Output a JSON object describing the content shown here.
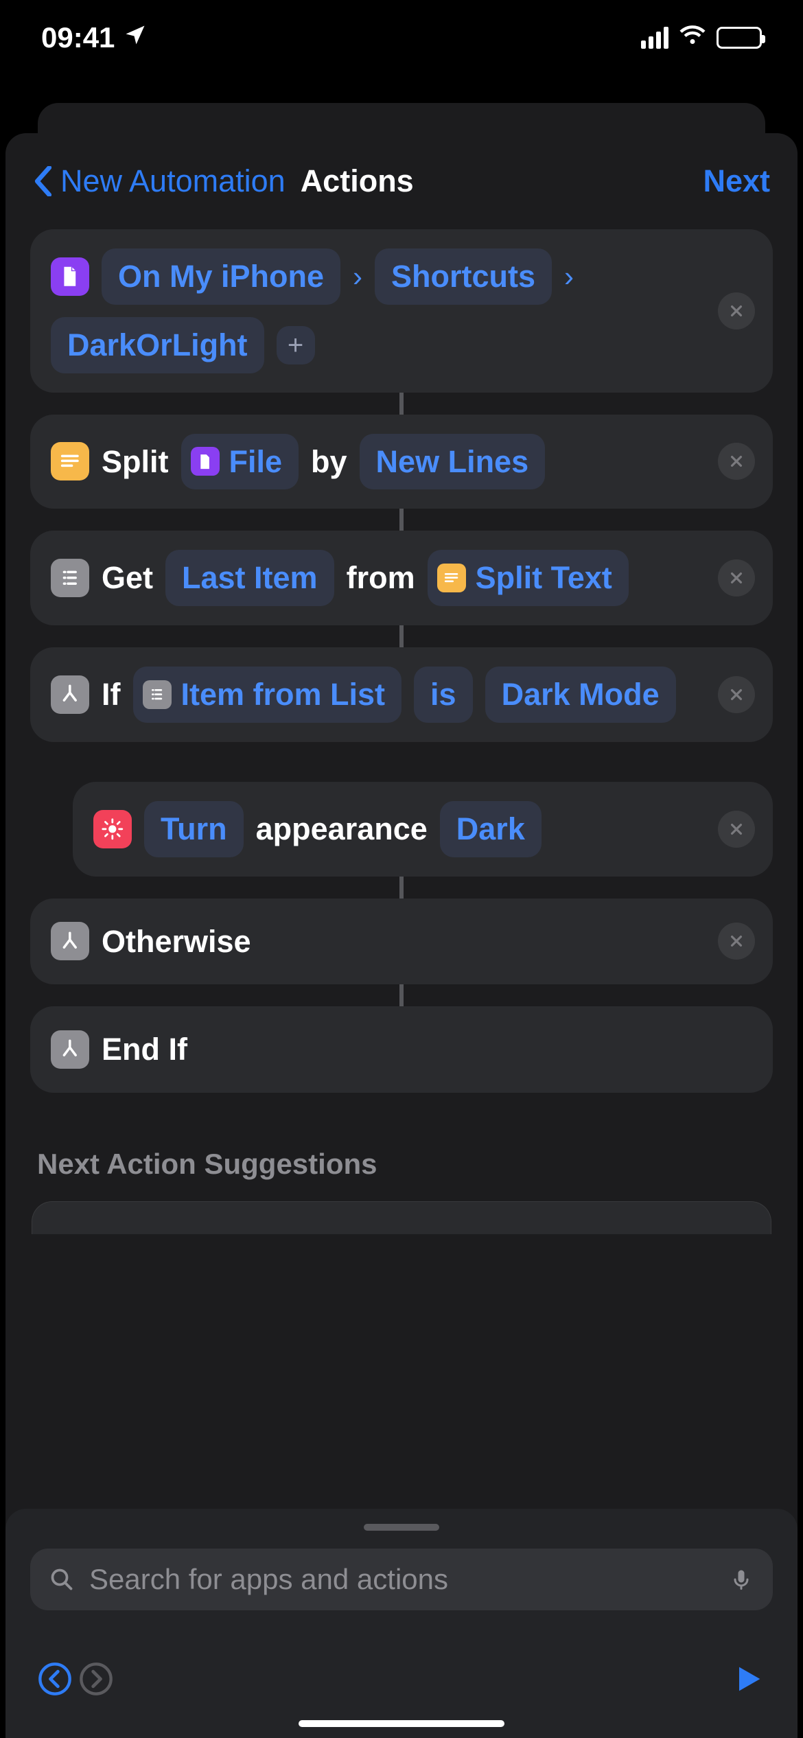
{
  "status": {
    "time": "09:41"
  },
  "nav": {
    "back": "New Automation",
    "title": "Actions",
    "next": "Next"
  },
  "actions": {
    "file": {
      "path": [
        "On My iPhone",
        "Shortcuts"
      ],
      "filename": "DarkOrLight"
    },
    "split": {
      "verb": "Split",
      "input": "File",
      "by_word": "by",
      "mode": "New Lines"
    },
    "get": {
      "verb": "Get",
      "which": "Last Item",
      "from_word": "from",
      "source": "Split Text"
    },
    "if": {
      "verb": "If",
      "subject": "Item from List",
      "cond": "is",
      "value": "Dark Mode"
    },
    "turn": {
      "verb": "Turn",
      "target": "appearance",
      "value": "Dark"
    },
    "otherwise": "Otherwise",
    "endif": "End If"
  },
  "suggestions_title": "Next Action Suggestions",
  "search_placeholder": "Search for apps and actions"
}
